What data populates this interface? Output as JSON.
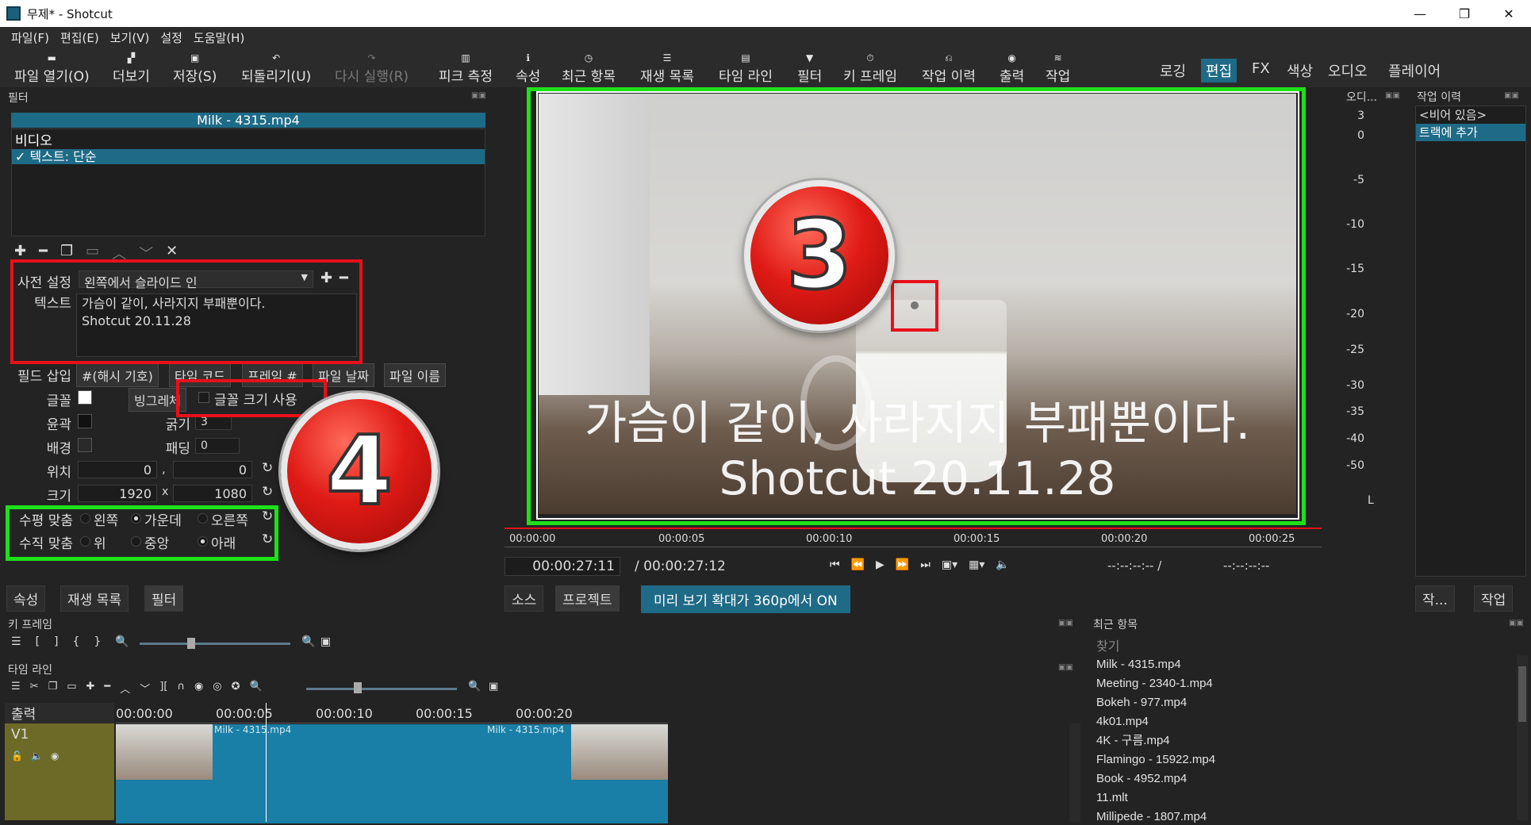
{
  "window": {
    "title": "무제* - Shotcut",
    "minimize": "—",
    "restore": "❐",
    "close": "✕"
  },
  "menu": [
    "파일(F)",
    "편집(E)",
    "보기(V)",
    "설정",
    "도움말(H)"
  ],
  "toolbar": {
    "open": "파일 열기(O)",
    "more": "더보기",
    "save": "저장(S)",
    "undo": "되돌리기(U)",
    "redo": "다시 실행(R)",
    "peak": "피크 측정",
    "props": "속성",
    "recent": "최근 항목",
    "playlist": "재생 목록",
    "timeline": "타임 라인",
    "filters": "필터",
    "keyframes": "키 프레임",
    "history": "작업 이력",
    "export": "출력",
    "jobs": "작업"
  },
  "modes": [
    "로깅",
    "편집",
    "FX",
    "색상",
    "오디오",
    "플레이어"
  ],
  "filter_panel": {
    "header": "필터",
    "clip": "Milk - 4315.mp4",
    "group": "비디오",
    "item": "텍스트: 단순"
  },
  "filter_form": {
    "preset_label": "사전 설정",
    "preset_value": "왼쪽에서 슬라이드 인",
    "text_label": "텍스트",
    "text_line1": "가슴이 같이, 사라지지 부패뿐이다.",
    "text_line2": "Shotcut 20.11.28",
    "insert_label": "필드 삽입",
    "insert_btns": [
      "#(해시 기호)",
      "타임 코드",
      "프레임 #",
      "파일 날짜",
      "파일 이름"
    ],
    "font_label": "글꼴",
    "bigger_btn": "빙그레체",
    "font_size_chk": "글꼴 크기 사용",
    "outline_label": "윤곽",
    "thickness_label": "굵기",
    "thickness": "3",
    "bg_label": "배경",
    "padding_label": "패딩",
    "padding": "0",
    "pos_label": "위치",
    "pos_x": "0",
    "pos_y": "0",
    "size_label": "크기",
    "size_w": "1920",
    "size_h": "1080",
    "halign_label": "수평 맞춤",
    "h_left": "왼쪽",
    "h_center": "가운데",
    "h_right": "오른쪽",
    "valign_label": "수직 맞춤",
    "v_top": "위",
    "v_mid": "중앙",
    "v_bottom": "아래",
    "comma": ",",
    "times": "x"
  },
  "left_tabs": [
    "속성",
    "재생 목록",
    "필터"
  ],
  "preview": {
    "subtitle1": "가슴이 같이, 사라지지 부패뿐이다.",
    "subtitle2": "Shotcut 20.11.28",
    "ruler": [
      "00:00:00",
      "00:00:05",
      "00:00:10",
      "00:00:15",
      "00:00:20",
      "00:00:25"
    ],
    "current_time": "00:00:27:11",
    "total_time": "/ 00:00:27:12",
    "in_point": "--:--:--:-- /",
    "out_point": "--:--:--:--",
    "tabs": [
      "소스",
      "프로젝트"
    ],
    "zoom_btn": "미리 보기 확대가 360p에서 ON"
  },
  "audio_meter": {
    "header": "오디...",
    "levels": [
      "3",
      "0",
      "-5",
      "-10",
      "-15",
      "-20",
      "-25",
      "-30",
      "-35",
      "-40",
      "-50"
    ],
    "channel": "L"
  },
  "history_panel": {
    "header": "작업 이력",
    "items": [
      "<비어 있음>",
      "트랙에 추가"
    ],
    "tabs": [
      "작...",
      "작업"
    ]
  },
  "keyframes": {
    "header": "키 프레임"
  },
  "timeline": {
    "header": "타임 라인",
    "output_label": "출력",
    "track": "V1",
    "ruler": [
      "00:00:00",
      "00:00:05",
      "00:00:10",
      "00:00:15",
      "00:00:20"
    ],
    "clip_name": "Milk - 4315.mp4"
  },
  "recent": {
    "header": "최근 항목",
    "search_placeholder": "찾기",
    "items": [
      "Milk - 4315.mp4",
      "Meeting - 2340-1.mp4",
      "Bokeh - 977.mp4",
      "4k01.mp4",
      "4K - 구름.mp4",
      "Flamingo - 15922.mp4",
      "Book - 4952.mp4",
      "11.mlt",
      "Millipede - 1807.mp4"
    ]
  },
  "badges": {
    "three": "3",
    "four": "4"
  },
  "colors": {
    "accent": "#1f6a86",
    "annotation_red": "#e8101a",
    "annotation_green": "#1ee01a"
  }
}
